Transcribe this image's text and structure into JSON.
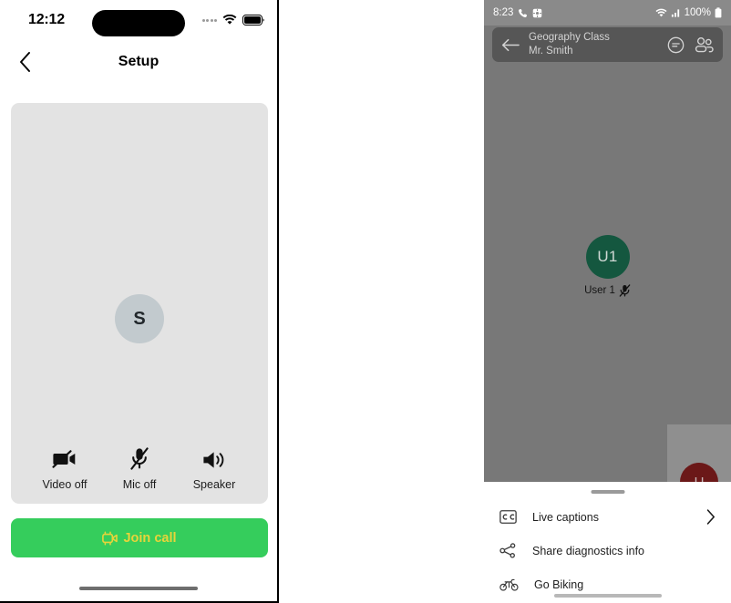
{
  "ios_phone": {
    "status_bar": {
      "time": "12:12",
      "cellular_icon": "cellular-dots-icon",
      "wifi_icon": "wifi-icon",
      "battery_icon": "battery-full-icon"
    },
    "nav_bar": {
      "back_icon": "chevron-left-icon",
      "title": "Setup"
    },
    "preview": {
      "avatar_initial": "S",
      "controls": [
        {
          "label": "Video off",
          "icon": "video-off-icon"
        },
        {
          "label": "Mic off",
          "icon": "mic-off-icon"
        },
        {
          "label": "Speaker",
          "icon": "speaker-on-icon"
        }
      ]
    },
    "join_button": {
      "label": "Join call",
      "icon": "video-camera-icon",
      "background_color": "#35cd5c",
      "text_color": "#e8d43a"
    }
  },
  "android_phone": {
    "status_bar": {
      "time": "8:23",
      "phone_icon": "phone-call-icon",
      "app_icon": "app-badge-icon",
      "wifi_icon": "wifi-icon",
      "signal_icon": "signal-bars-icon",
      "battery_percent": "100%",
      "battery_icon": "battery-full-icon"
    },
    "call_header": {
      "back_icon": "arrow-left-icon",
      "title": "Geography Class",
      "subtitle": "Mr. Smith",
      "chat_icon": "chat-bubble-icon",
      "participants_icon": "people-icon"
    },
    "participant": {
      "avatar_initials": "U1",
      "avatar_color": "#14573f",
      "name": "User 1",
      "mic_status_icon": "mic-muted-icon"
    },
    "self_view": {
      "avatar_initial": "U",
      "avatar_color": "#6b1818"
    },
    "bottom_sheet": {
      "handle": "drag-handle",
      "items": [
        {
          "label": "Live captions",
          "icon": "closed-captions-icon",
          "chevron": "chevron-right-icon"
        },
        {
          "label": "Share diagnostics info",
          "icon": "share-icon",
          "chevron": ""
        },
        {
          "label": "Go Biking",
          "icon": "bicycle-icon",
          "chevron": ""
        }
      ]
    }
  }
}
